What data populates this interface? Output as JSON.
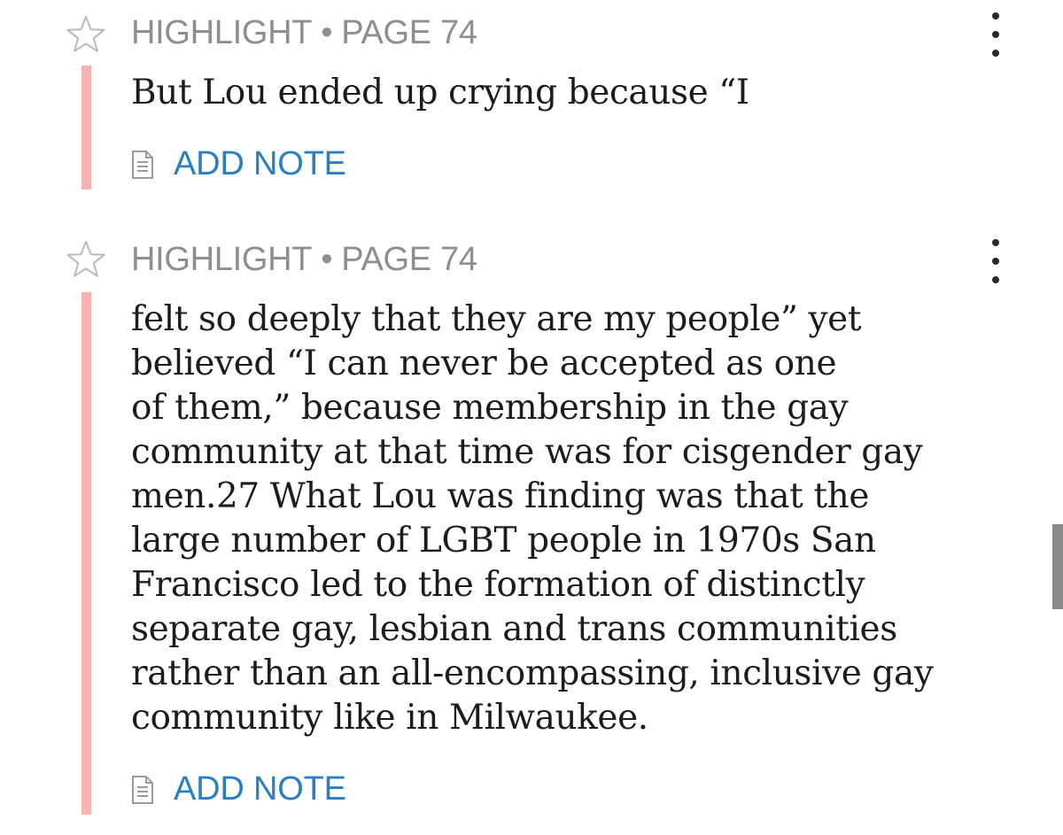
{
  "highlights": [
    {
      "type": "HIGHLIGHT",
      "separator": "•",
      "page": "PAGE 74",
      "text": "But Lou ended up crying because “I",
      "add_note_label": "ADD NOTE",
      "highlight_color": "#f7b2b2"
    },
    {
      "type": "HIGHLIGHT",
      "separator": "•",
      "page": "PAGE 74",
      "text_lines": [
        "felt so deeply that they are my people” yet",
        "believed “I can never be accepted as one",
        "of them,” because membership in the gay",
        "community at that time was for cisgender gay",
        "men.27 What Lou was finding was that the",
        "large number of LGBT people in 1970s San",
        "Francisco led to the formation of distinctly",
        "separate gay, lesbian and trans communities",
        "rather than an all-encompassing, inclusive gay",
        "community like in Milwaukee."
      ],
      "add_note_label": "ADD NOTE",
      "highlight_color": "#f7b2b2"
    }
  ],
  "icons": {
    "favorite": "star-outline-icon",
    "menu": "more-vertical-icon",
    "note": "note-document-icon"
  },
  "colors": {
    "header_text": "#8e8e8e",
    "link": "#2a7fc2",
    "body_text": "#1c1c1c"
  }
}
